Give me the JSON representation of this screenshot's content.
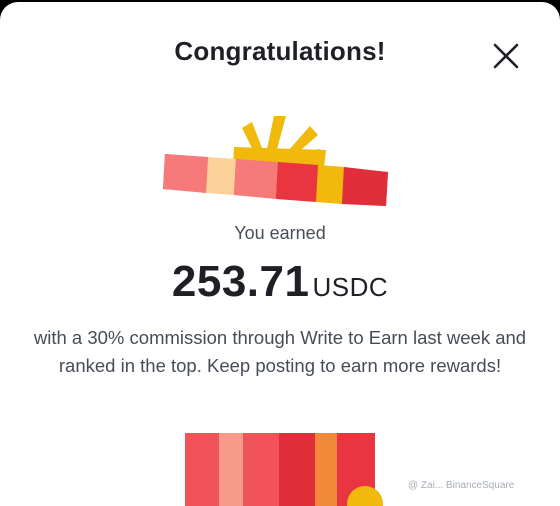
{
  "dialog": {
    "title": "Congratulations!",
    "close_icon": "close-icon",
    "earned_label": "You earned",
    "amount": "253.71",
    "currency": "USDC",
    "description": "with a 30% commission through Write to Earn last week and ranked in the top. Keep posting to earn more rewards!",
    "watermark": "@ Zai... BinanceSquare"
  },
  "colors": {
    "title": "#1e2026",
    "body_text": "#474d57",
    "gift_red": "#e8353f",
    "gift_pink": "#f77a7a",
    "gift_yellow": "#f0b90b"
  }
}
